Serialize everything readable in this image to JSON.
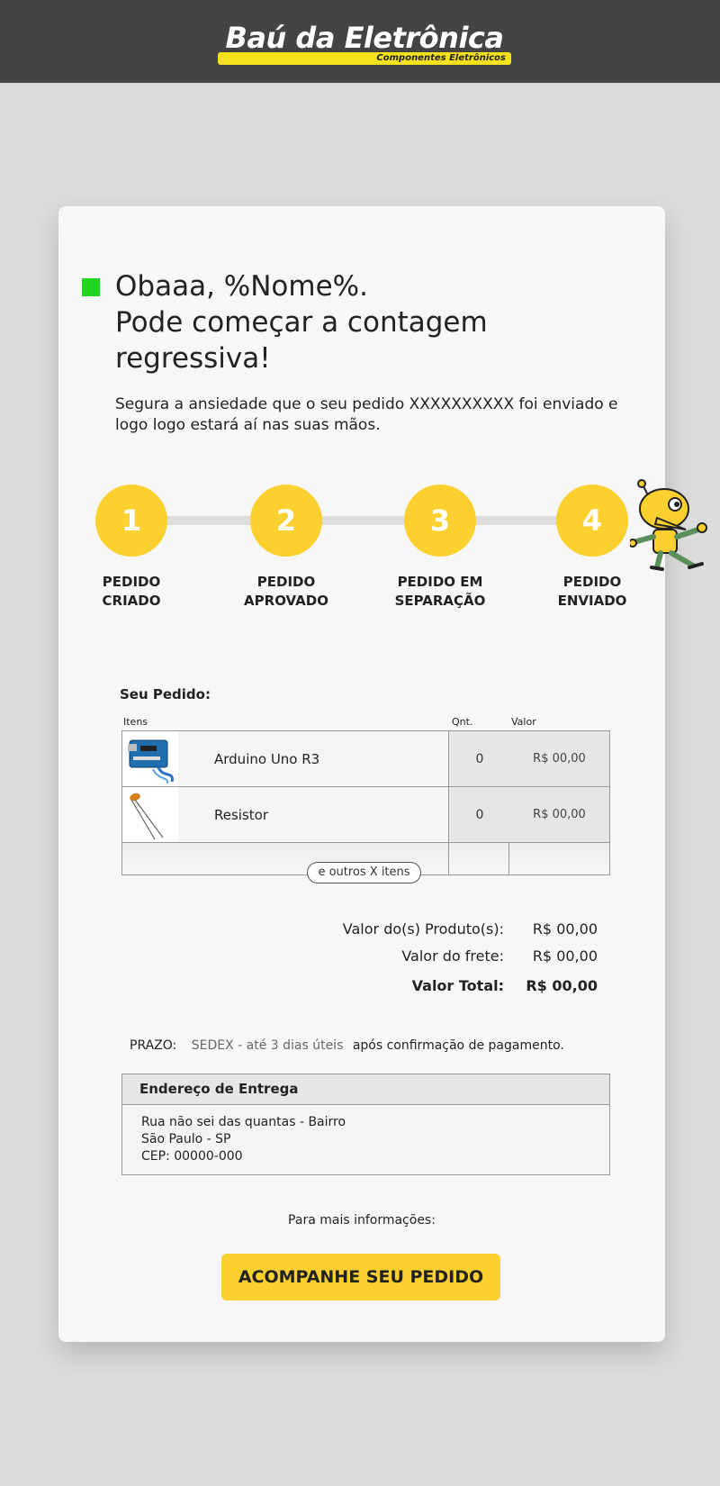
{
  "brand": {
    "name": "Baú da Eletrônica",
    "tagline": "Componentes Eletrônicos",
    "accent_color": "#fcd02f",
    "header_bg": "#444444"
  },
  "headline": {
    "line1": "Obaaa, %Nome%.",
    "line2": "Pode começar a contagem",
    "line3": "regressiva!"
  },
  "intro": "Segura a ansiedade que o seu pedido XXXXXXXXXX foi enviado e logo logo estará aí nas suas mãos.",
  "steps": [
    {
      "number": "1",
      "label_line1": "PEDIDO",
      "label_line2": "CRIADO"
    },
    {
      "number": "2",
      "label_line1": "PEDIDO",
      "label_line2": "APROVADO"
    },
    {
      "number": "3",
      "label_line1": "PEDIDO EM",
      "label_line2": "SEPARAÇÃO"
    },
    {
      "number": "4",
      "label_line1": "PEDIDO",
      "label_line2": "ENVIADO"
    }
  ],
  "order": {
    "title": "Seu Pedido:",
    "columns": {
      "items": "Itens",
      "qty": "Qnt.",
      "value": "Valor"
    },
    "rows": [
      {
        "name": "Arduino Uno R3",
        "qty": "0",
        "value": "R$ 00,00",
        "icon": "arduino-board-icon"
      },
      {
        "name": "Resistor",
        "qty": "0",
        "value": "R$ 00,00",
        "icon": "resistor-icon"
      }
    ],
    "more_items": "e outros X itens"
  },
  "totals": {
    "products_label": "Valor do(s) Produto(s):",
    "products_value": "R$ 00,00",
    "shipping_label": "Valor do frete:",
    "shipping_value": "R$ 00,00",
    "total_label": "Valor Total:",
    "total_value": "R$ 00,00"
  },
  "deadline": {
    "label": "PRAZO:",
    "method": "SEDEX - até 3 dias úteis",
    "note": "após confirmação de pagamento."
  },
  "address": {
    "title": "Endereço de Entrega",
    "line1": "Rua não sei das quantas - Bairro",
    "line2": "São Paulo - SP",
    "line3": "CEP: 00000-000"
  },
  "footer": {
    "more_info": "Para mais informações:",
    "cta_label": "ACOMPANHE SEU PEDIDO"
  }
}
